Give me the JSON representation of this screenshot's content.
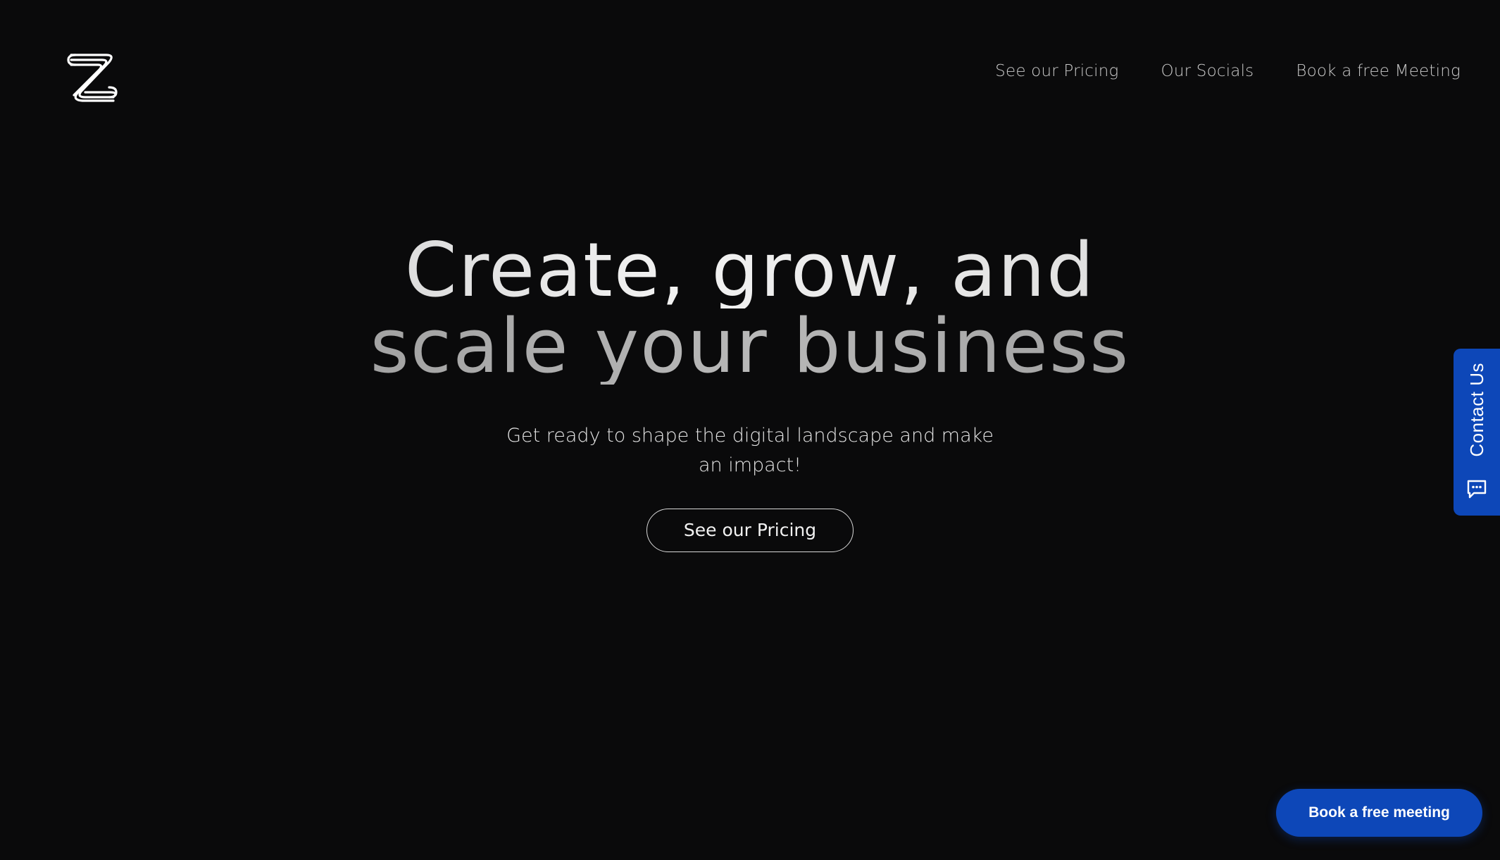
{
  "header": {
    "logo_icon": "z-stripes-logo-icon",
    "nav": [
      {
        "label": "See our Pricing"
      },
      {
        "label": "Our Socials"
      },
      {
        "label": "Book a free Meeting"
      }
    ]
  },
  "hero": {
    "headline_line1": "Create, grow, and",
    "headline_line2": "scale your business",
    "subtext": "Get ready to shape the digital landscape and make an impact!",
    "cta_label": "See our Pricing"
  },
  "contact_tab": {
    "label": "Contact Us",
    "icon": "chat-bubble-icon"
  },
  "floating": {
    "book_label": "Book a free meeting"
  },
  "colors": {
    "background": "#0a0a0b",
    "accent_blue": "#0d47b8",
    "text": "#e8e8e8"
  }
}
